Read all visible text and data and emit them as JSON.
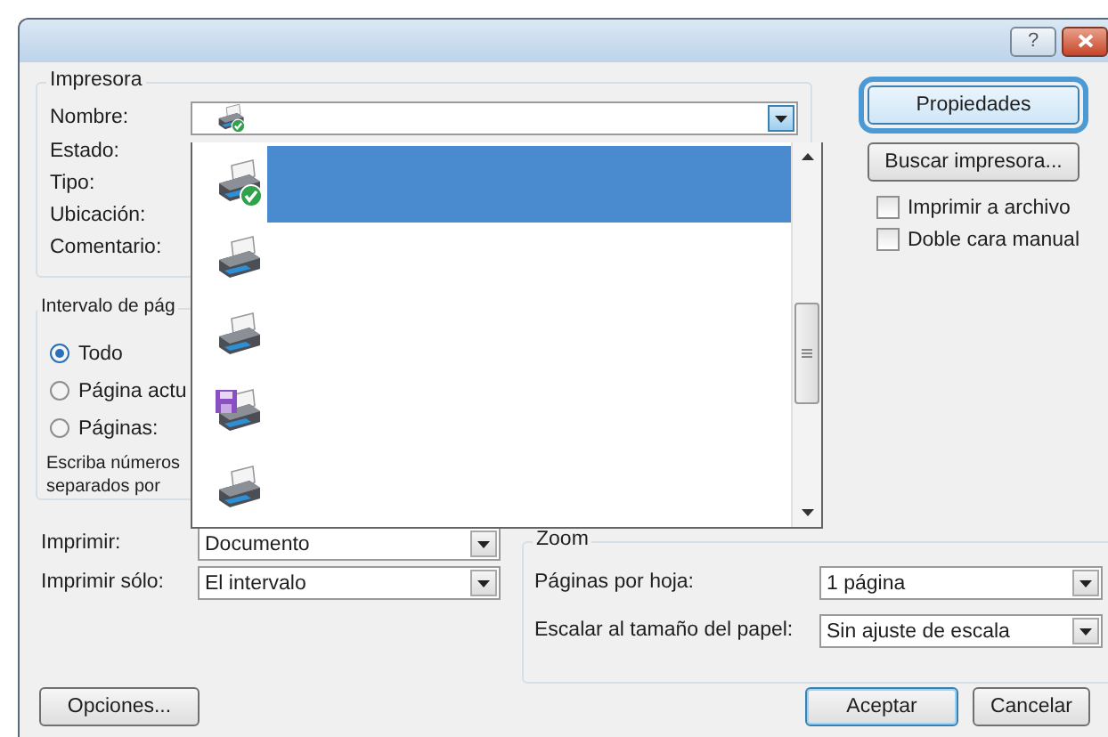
{
  "window": {
    "help_button": "?"
  },
  "printer": {
    "title": "Impresora",
    "name_label": "Nombre:",
    "info_labels": [
      "Estado:",
      "Tipo:",
      "Ubicación:",
      "Comentario:"
    ]
  },
  "right_buttons": [
    {
      "label": "Propiedades",
      "focused": true
    },
    {
      "label": "Buscar impresora...",
      "focused": false
    }
  ],
  "checkboxes": [
    {
      "label": "Imprimir a archivo",
      "checked": false
    },
    {
      "label": "Doble cara manual",
      "checked": false
    }
  ],
  "printer_list": [
    {
      "kind": "default",
      "selected": true
    },
    {
      "kind": "printer",
      "selected": false
    },
    {
      "kind": "printer",
      "selected": false
    },
    {
      "kind": "file",
      "selected": false
    },
    {
      "kind": "printer",
      "selected": false
    }
  ],
  "range": {
    "title": "Intervalo de pág",
    "options": [
      {
        "label": "Todo",
        "selected": true
      },
      {
        "label": "Página actu",
        "selected": false
      },
      {
        "label": "Páginas:",
        "selected": false
      }
    ],
    "hint_lines": [
      "Escriba números",
      "separados por"
    ]
  },
  "print_fields": [
    {
      "label": "Imprimir:",
      "value": "Documento"
    },
    {
      "label": "Imprimir sólo:",
      "value": "El intervalo"
    }
  ],
  "zoom": {
    "title": "Zoom",
    "fields": [
      {
        "label": "Páginas por hoja:",
        "value": "1 página"
      },
      {
        "label": "Escalar al tamaño del papel:",
        "value": "Sin ajuste de escala"
      }
    ]
  },
  "buttons": [
    {
      "label": "Opciones...",
      "default": false
    },
    {
      "label": "Aceptar",
      "default": true
    },
    {
      "label": "Cancelar",
      "default": false
    }
  ]
}
